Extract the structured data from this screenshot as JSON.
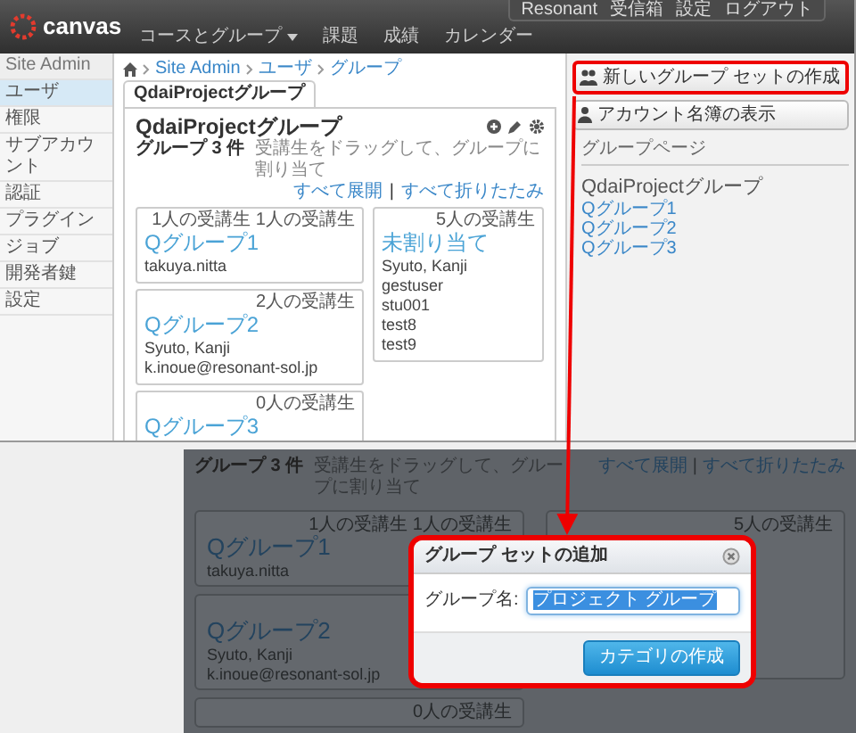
{
  "top_window": {
    "nav": {
      "logo": "canvas",
      "menu": [
        {
          "label": "コースとグループ",
          "kind": "dropdown"
        },
        {
          "label": "課題",
          "kind": "link"
        },
        {
          "label": "成績",
          "kind": "link"
        },
        {
          "label": "カレンダー",
          "kind": "link"
        }
      ],
      "user_links": [
        "Resonant",
        "受信箱",
        "設定",
        "ログアウト"
      ]
    },
    "sidebar": {
      "title": "Site Admin",
      "items": [
        {
          "label": "ユーザ",
          "selected": true
        },
        {
          "label": "権限",
          "selected": false
        },
        {
          "label": "サブアカウント",
          "selected": false
        },
        {
          "label": "認証",
          "selected": false
        },
        {
          "label": "プラグイン",
          "selected": false
        },
        {
          "label": "ジョブ",
          "selected": false
        },
        {
          "label": "開発者鍵",
          "selected": false
        },
        {
          "label": "設定",
          "selected": false
        }
      ]
    },
    "breadcrumb": [
      "Site Admin",
      "ユーザ",
      "グループ"
    ],
    "tabs": [
      {
        "label": "QdaiProjectグループ",
        "selected": true
      }
    ],
    "group_set": {
      "title": "QdaiProjectグループ",
      "count": "グループ 3 件",
      "hint": "受講生をドラッグして、グループに割り当て",
      "expand_all": "すべて展開",
      "separator": "|",
      "collapse_all": "すべて折りたたみ",
      "groups": [
        {
          "name": "Qグループ1",
          "badge": "1人の受講生 1人の受講生",
          "members": [
            "takuya.nitta"
          ]
        },
        {
          "name": "Qグループ2",
          "badge": "2人の受講生",
          "members": [
            "Syuto, Kanji",
            "k.inoue@resonant-sol.jp"
          ]
        },
        {
          "name": "Qグループ3",
          "badge": "0人の受講生"
        }
      ],
      "unassigned": {
        "title": "未割り当て",
        "badge": "5人の受講生",
        "members": [
          "Syuto, Kanji",
          "gestuser",
          "stu001",
          "test8",
          "test9"
        ]
      }
    },
    "actions": [
      {
        "label": "新しいグループ セットの作成",
        "kind": "group",
        "highlighted": true
      },
      {
        "label": "アカウント名簿の表示",
        "kind": "person",
        "highlighted": false
      }
    ],
    "group_page": {
      "heading": "グループページ",
      "title": "QdaiProjectグループ",
      "links": [
        "Qグループ1",
        "Qグループ2",
        "Qグループ3"
      ]
    }
  },
  "detail_view": {
    "count": "グループ 3 件",
    "hint": "受講生をドラッグして、グループに割り当て",
    "expand_all": "すべて展開",
    "separator": "|",
    "collapse_all": "すべて折りたたみ",
    "groups": [
      {
        "name": "Qグループ1",
        "badge": "1人の受講生 1人の受講生",
        "members": [
          "takuya.nitta"
        ]
      },
      {
        "name": "Qグループ2",
        "members": [
          "Syuto, Kanji",
          "k.inoue@resonant-sol.jp"
        ]
      },
      {
        "badge": "0人の受講生"
      }
    ],
    "unassigned": {
      "badge": "5人の受講生"
    },
    "dialog": {
      "title": "グループ セットの追加",
      "field_label": "グループ名:",
      "value": "プロジェクト グループ",
      "value_selected": true,
      "button": "カテゴリの作成",
      "highlighted": true
    }
  }
}
